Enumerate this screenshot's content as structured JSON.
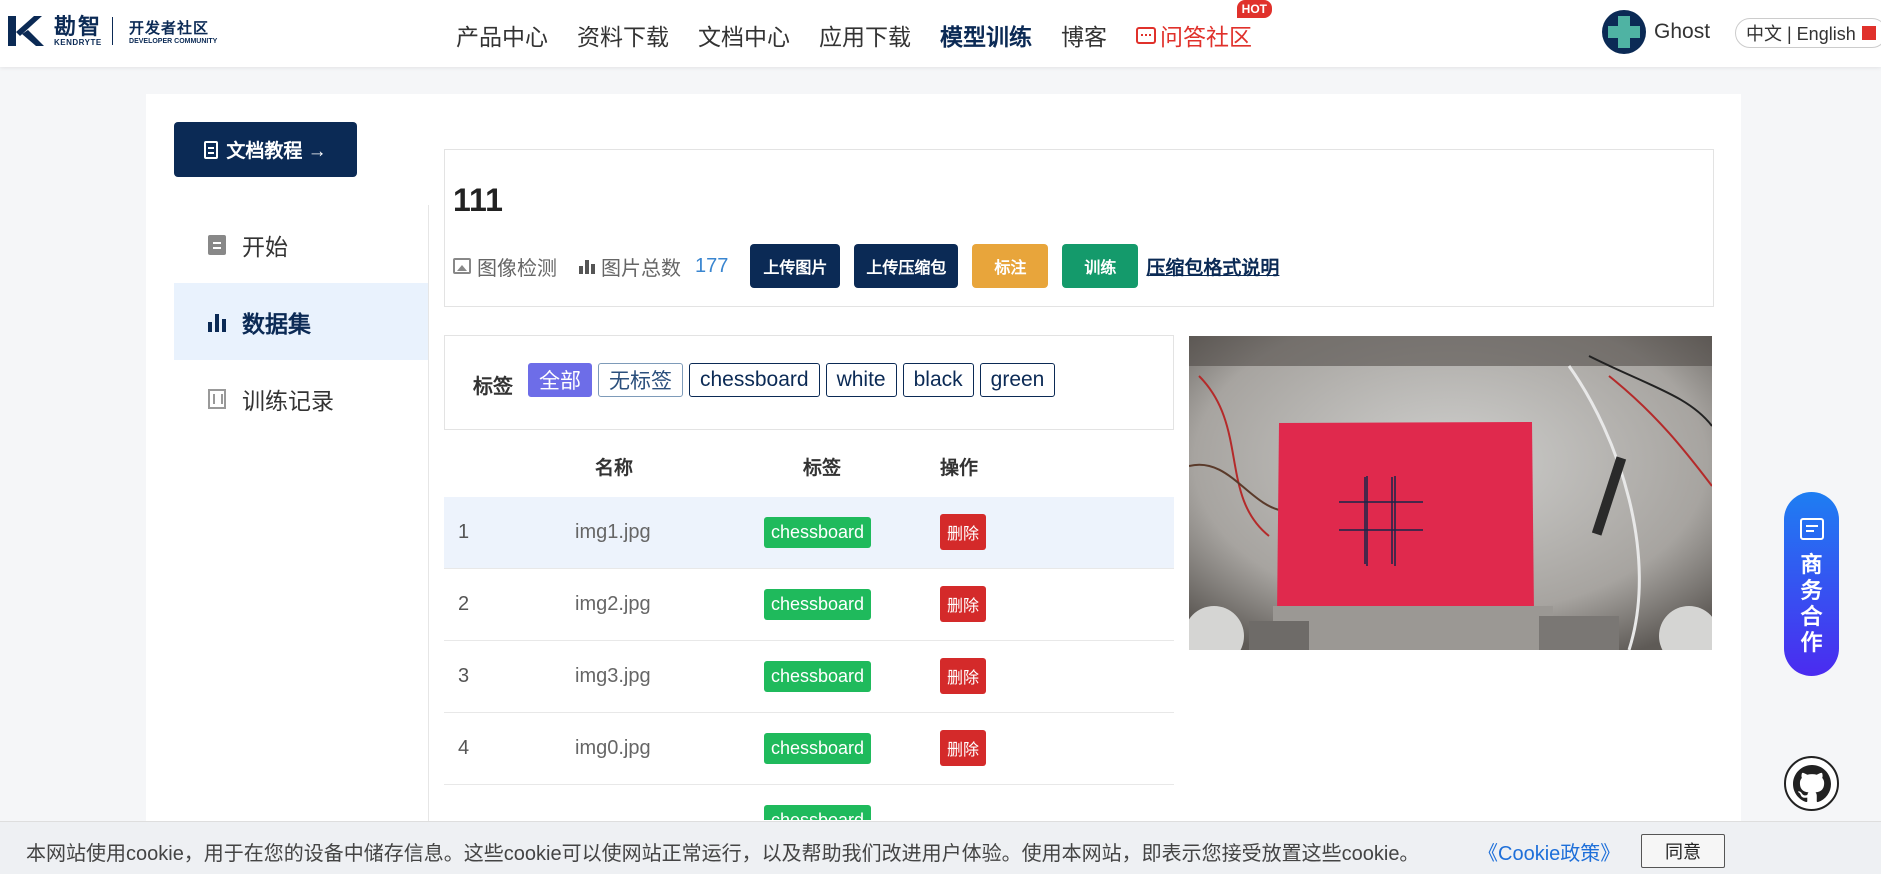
{
  "header": {
    "logo_cn": "勘智",
    "logo_en": "KENDRYTE",
    "community_cn": "开发者社区",
    "community_en": "DEVELOPER COMMUNITY",
    "nav": [
      {
        "label": "产品中心"
      },
      {
        "label": "资料下载"
      },
      {
        "label": "文档中心"
      },
      {
        "label": "应用下载"
      },
      {
        "label": "模型训练"
      },
      {
        "label": "博客"
      },
      {
        "label": "问答社区"
      }
    ],
    "hot_badge": "HOT",
    "user_name": "Ghost",
    "language": "中文 | English"
  },
  "sidebar": {
    "doc_button": "文档教程 →",
    "items": [
      {
        "label": "开始"
      },
      {
        "label": "数据集"
      },
      {
        "label": "训练记录"
      }
    ]
  },
  "dataset": {
    "title": "111",
    "type": "图像检测",
    "count_label": "图片总数",
    "count": "177",
    "buttons": {
      "upload_images": "上传图片",
      "upload_zip": "上传压缩包",
      "annotate": "标注",
      "train": "训练"
    },
    "format_link": "压缩包格式说明"
  },
  "tags": {
    "label": "标签",
    "items": [
      "全部",
      "无标签",
      "chessboard",
      "white",
      "black",
      "green"
    ]
  },
  "table": {
    "headers": {
      "name": "名称",
      "tag": "标签",
      "action": "操作"
    },
    "rows": [
      {
        "index": "1",
        "name": "img1.jpg",
        "tag": "chessboard",
        "action": "删除"
      },
      {
        "index": "2",
        "name": "img2.jpg",
        "tag": "chessboard",
        "action": "删除"
      },
      {
        "index": "3",
        "name": "img3.jpg",
        "tag": "chessboard",
        "action": "删除"
      },
      {
        "index": "4",
        "name": "img0.jpg",
        "tag": "chessboard",
        "action": "删除"
      },
      {
        "index": "",
        "name": "",
        "tag": "chessboard",
        "action": ""
      }
    ]
  },
  "floating": {
    "business": "商务合作"
  },
  "cookie": {
    "text": "本网站使用cookie，用于在您的设备中储存信息。这些cookie可以使网站正常运行，以及帮助我们改进用户体验。使用本网站，即表示您接受放置这些cookie。",
    "policy_link": "《Cookie政策》",
    "accept": "同意"
  },
  "colors": {
    "brand_navy": "#0b2a55",
    "accent_red": "#e0312b",
    "tag_green": "#1fba5c",
    "delete_red": "#d42a2a"
  }
}
